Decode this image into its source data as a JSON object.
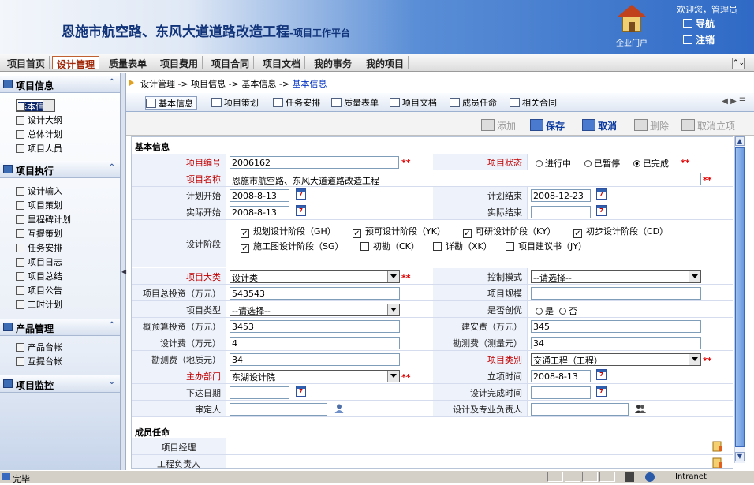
{
  "header": {
    "title_main": "恩施市航空路、东风大道道路改造工程",
    "title_sub": "-项目工作平台",
    "portal_label": "企业门户",
    "welcome": "欢迎您，管理员",
    "nav_link": "导航",
    "logout_link": "注销"
  },
  "menu": [
    "项目首页",
    "设计管理",
    "质量表单",
    "项目费用",
    "项目合同",
    "项目文档",
    "我的事务",
    "我的项目"
  ],
  "sidebar": {
    "groups": [
      {
        "title": "项目信息",
        "items": [
          "基本信息",
          "设计大纲",
          "总体计划",
          "项目人员"
        ]
      },
      {
        "title": "项目执行",
        "items": [
          "设计输入",
          "项目策划",
          "里程碑计划",
          "互提策划",
          "任务安排",
          "项目日志",
          "项目总结",
          "项目公告",
          "工时计划"
        ]
      },
      {
        "title": "产品管理",
        "items": [
          "产品台帐",
          "互提台帐"
        ]
      },
      {
        "title": "项目监控",
        "items": []
      }
    ]
  },
  "breadcrumb": "设计管理 -> 项目信息 -> 基本信息 -> ",
  "breadcrumb_current": "基本信息",
  "tabs": [
    "基本信息",
    "项目策划",
    "任务安排",
    "质量表单",
    "项目文档",
    "成员任命",
    "相关合同"
  ],
  "actions": {
    "add": "添加",
    "save": "保存",
    "cancel": "取消",
    "delete": "删除",
    "cancel_approve": "取消立项"
  },
  "form": {
    "section_basic": "基本信息",
    "labels": {
      "project_no": "项目编号",
      "project_status": "项目状态",
      "project_name": "项目名称",
      "plan_start": "计划开始",
      "plan_end": "计划结束",
      "actual_start": "实际开始",
      "actual_end": "实际结束",
      "design_stage": "设计阶段",
      "category": "项目大类",
      "control_mode": "控制模式",
      "total_invest": "项目总投资（万元）",
      "scale": "项目规模",
      "project_type": "项目类型",
      "is_excellent": "是否创优",
      "budget": "概预算投资（万元）",
      "construction_fee": "建安费（万元）",
      "design_fee": "设计费（万元）",
      "survey_fee_measure": "勘测费（测量元）",
      "survey_fee_geo": "勘测费（地质元）",
      "project_class": "项目类别",
      "lead_dept": "主办部门",
      "approve_time": "立项时间",
      "issue_date": "下达日期",
      "design_done_time": "设计完成时间",
      "reviewer": "审定人",
      "design_chief": "设计及专业负责人"
    },
    "values": {
      "project_no": "2006162",
      "project_name": "恩施市航空路、东风大道道路改造工程",
      "plan_start": "2008-8-13",
      "plan_end": "2008-12-23",
      "actual_start": "2008-8-13",
      "actual_end": "",
      "category": "设计类",
      "control_mode": "--请选择--",
      "total_invest": "543543",
      "scale": "",
      "project_type": "--请选择--",
      "budget": "3453",
      "construction_fee": "345",
      "design_fee": "4",
      "survey_fee_measure": "34",
      "survey_fee_geo": "34",
      "project_class": "交通工程（工程）",
      "lead_dept": "东湖设计院",
      "approve_time": "2008-8-13",
      "issue_date": "",
      "design_done_time": "",
      "reviewer": "",
      "design_chief": ""
    },
    "status_options": [
      {
        "label": "进行中",
        "checked": false
      },
      {
        "label": "已暂停",
        "checked": false
      },
      {
        "label": "已完成",
        "checked": true
      }
    ],
    "excellent_options": [
      {
        "label": "是",
        "checked": false
      },
      {
        "label": "否",
        "checked": false
      }
    ],
    "stages": [
      {
        "label": "规划设计阶段（GH）",
        "checked": true
      },
      {
        "label": "预可设计阶段（YK）",
        "checked": true
      },
      {
        "label": "可研设计阶段（KY）",
        "checked": true
      },
      {
        "label": "初步设计阶段（CD）",
        "checked": true
      },
      {
        "label": "施工图设计阶段（SG）",
        "checked": true
      },
      {
        "label": "初勘（CK）",
        "checked": false
      },
      {
        "label": "详勘（XK）",
        "checked": false
      },
      {
        "label": "项目建议书（JY）",
        "checked": false
      }
    ],
    "required_mark": "**",
    "section_members": "成员任命",
    "member_labels": [
      "项目经理",
      "工程负责人"
    ]
  },
  "statusbar": {
    "text": "完毕",
    "zone": "Intranet"
  }
}
